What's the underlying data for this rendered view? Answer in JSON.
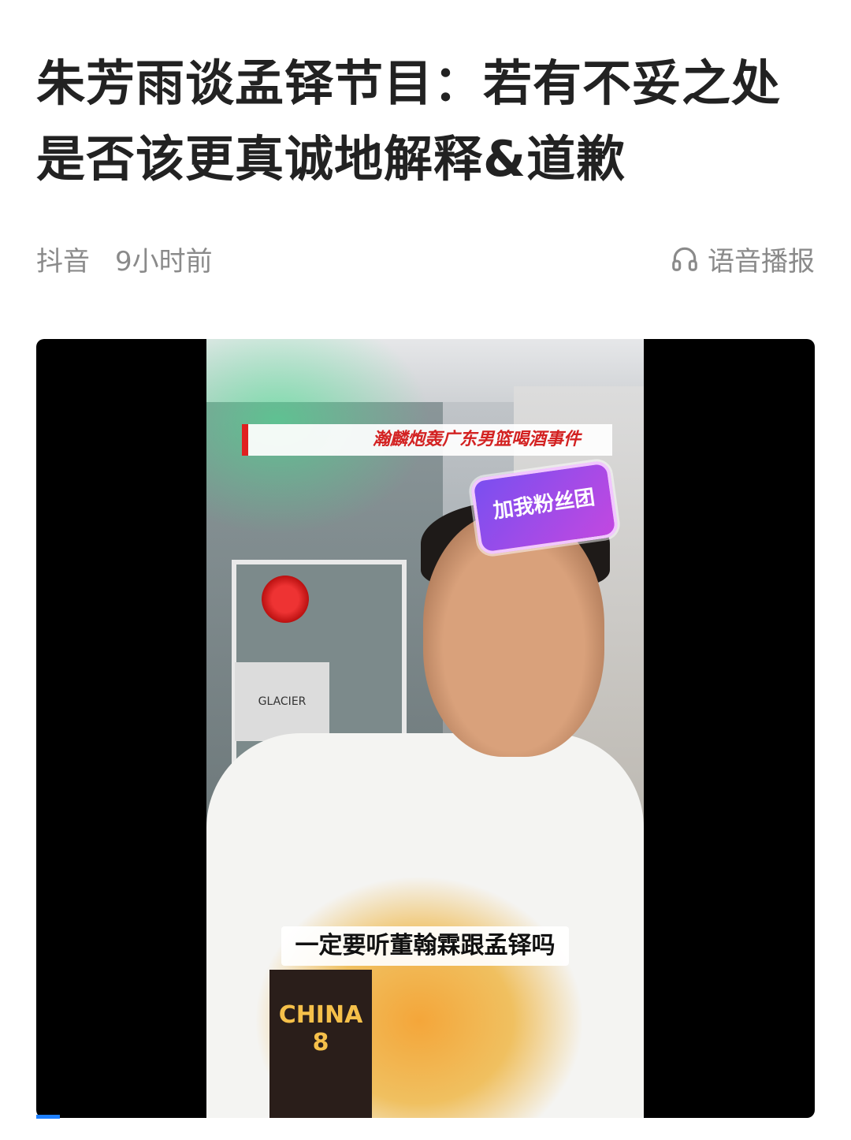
{
  "article": {
    "title": "朱芳雨谈孟铎节目：若有不妥之处是否该更真诚地解释&道歉",
    "source": "抖音",
    "time": "9小时前",
    "audio_label": "语音播报"
  },
  "video": {
    "banner_text": "瀚麟炮轰广东男篮喝酒事件",
    "fan_badge_text": "加我粉丝团",
    "subtitle_text": "一定要听董翰霖跟孟铎吗",
    "box_text": "GLACIER",
    "jersey_text": "CHINA 8",
    "progress_percent": 3
  },
  "colors": {
    "title": "#222222",
    "meta": "#8a8a8a",
    "progress": "#1e80ff",
    "banner_red": "#d32222"
  },
  "icons": {
    "audio": "headphone-icon"
  }
}
